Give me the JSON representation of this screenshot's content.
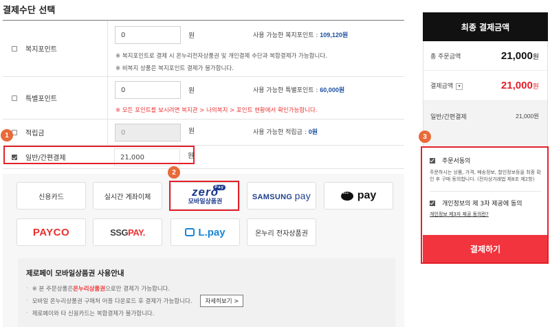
{
  "section_title": "결제수단 선택",
  "points": {
    "welfare": {
      "label": "복지포인트",
      "value": "0",
      "unit": "원",
      "available_label": "사용 가능한 복지포인트 :",
      "available_value": "109,120원",
      "notes": [
        "※ 복지포인트로 결제 시 온누리전자상품권 및 개인결제 수단과 복합결제가 가능합니다.",
        "※ 비복지 상품은 복지포인트 결제가 불가합니다."
      ]
    },
    "special": {
      "label": "특별포인트",
      "value": "0",
      "unit": "원",
      "available_label": "사용 가능한 특별포인트 :",
      "available_value": "60,000원",
      "note": "※ 모든 포인트를 보시려면 복지관 > 나의복지 > 포인트 현황에서 확인가능합니다."
    },
    "reserve": {
      "label": "적립금",
      "value": "0",
      "unit": "원",
      "available_label": "사용 가능한 적립금 :",
      "available_value": "0원"
    },
    "general": {
      "label": "일반/간편결제",
      "value": "21,000",
      "unit": "원"
    }
  },
  "markers": [
    "1",
    "2",
    "3"
  ],
  "pay_methods": {
    "credit_card": "신용카드",
    "realtime_transfer": "실시간 계좌이체",
    "zeropay_top": "zero",
    "zeropay_badge": "Pay",
    "zeropay_bottom": "모바일상품권",
    "samsung_pay_a": "SAMSUNG ",
    "samsung_pay_b": "pay",
    "naver_pay": "pay",
    "payco": "PAYCO",
    "ssgpay_a": "SSG",
    "ssgpay_b": "PAY.",
    "lpay": "L.pay",
    "onnuri": "온누리 전자상품권"
  },
  "info": {
    "title": "제로페이 모바일상품권 사용안내",
    "line1_prefix": "※ 본 주문상품은 ",
    "line1_highlight": "온누리상품권",
    "line1_suffix": " 으로만 결제가 가능합니다.",
    "line2": "모바일 온누리상품권 구매처 어플 다운로드 후 결제가 가능합니다.",
    "more_button": "자세히보기 >",
    "line3": "제로페이와 타 신용카드는 복합결제가 불가합니다."
  },
  "summary": {
    "title": "최종 결제금액",
    "order_amount_label": "총 주문금액",
    "order_amount": "21,000",
    "pay_amount_label": "결제금액",
    "pay_amount": "21,000",
    "won": "원",
    "general_label": "일반/간편결제",
    "general_amount": "21,000원"
  },
  "agreements": {
    "order_agree_label": "주문서동의",
    "order_agree_desc": "주문하시는 상품, 가격, 배송정보, 할인정보등을 최종 확인 후 구매 동의합니다. (전자상거래법 제8조 제2항)",
    "privacy_label": "개인정보의 제 3자 제공에 동의",
    "privacy_link": "개인정보 제3자 제공 동의란?"
  },
  "submit_label": "결제하기",
  "colors": {
    "accent_red": "#f1343d",
    "marker_orange": "#e86a3a",
    "highlight_box": "#e3202a",
    "link_blue": "#1a4fa0"
  }
}
